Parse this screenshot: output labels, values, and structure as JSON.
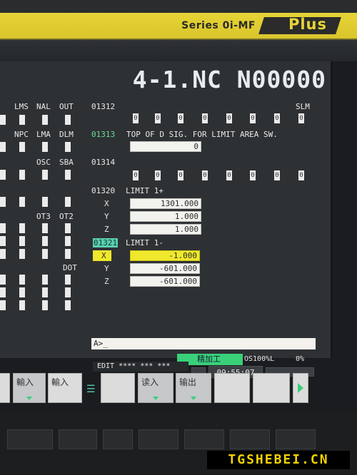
{
  "header": {
    "series": "Series 0i-MF",
    "plus": "Plus"
  },
  "screen": {
    "program_title": "4-1.NC N00000",
    "left_labels": {
      "row1": [
        "LMS",
        "NAL",
        "OUT"
      ],
      "row2": [
        "NPC",
        "LMA",
        "DLM"
      ],
      "row3": [
        "OSC",
        "SBA"
      ],
      "row4": [
        "OT3",
        "OT2"
      ],
      "row5": [
        "DOT"
      ]
    },
    "params": {
      "p01312": {
        "number": "01312",
        "bit_label": "SLM",
        "bits": [
          "0",
          "0",
          "0",
          "0",
          "0",
          "0",
          "0",
          "0"
        ]
      },
      "p01313": {
        "number": "01313",
        "desc": "TOP OF D SIG. FOR LIMIT AREA SW.",
        "value": "0"
      },
      "p01314": {
        "number": "01314",
        "bits": [
          "0",
          "0",
          "0",
          "0",
          "0",
          "0",
          "0",
          "0"
        ]
      },
      "p01320": {
        "number": "01320",
        "desc": "LIMIT 1+",
        "axes": [
          {
            "axis": "X",
            "value": "1301.000"
          },
          {
            "axis": "Y",
            "value": "1.000"
          },
          {
            "axis": "Z",
            "value": "1.000"
          }
        ]
      },
      "p01321": {
        "number": "01321",
        "desc": "LIMIT 1-",
        "axes": [
          {
            "axis": "X",
            "value": "-1.000"
          },
          {
            "axis": "Y",
            "value": "-601.000"
          },
          {
            "axis": "Z",
            "value": "-601.000"
          }
        ]
      }
    },
    "key_input": "A>_"
  },
  "status": {
    "mode": "精加工",
    "override": "OS100%L",
    "override2": "0%",
    "edit": "EDIT **** *** ***",
    "clock": "09:55:07"
  },
  "softkeys": {
    "k1": "輸入",
    "k2": "輸入",
    "k3": "读入",
    "k4": "输出"
  },
  "watermark": "TGSHEBEI.CN"
}
